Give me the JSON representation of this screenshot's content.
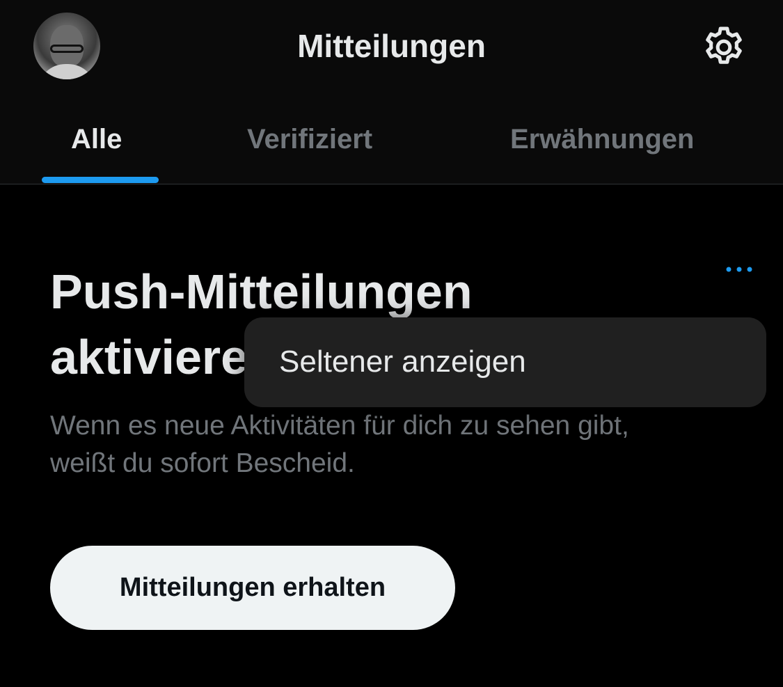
{
  "header": {
    "title": "Mitteilungen",
    "avatar_icon": "user-avatar",
    "settings_icon": "gear-icon"
  },
  "tabs": [
    {
      "label": "Alle",
      "active": true
    },
    {
      "label": "Verifiziert",
      "active": false
    },
    {
      "label": "Erwähnungen",
      "active": false
    }
  ],
  "prompt": {
    "headline": "Push-Mitteilungen aktivieren",
    "description": "Wenn es neue Aktivitäten für dich zu sehen gibt, weißt du sofort Bescheid.",
    "button_label": "Mitteilungen erhalten",
    "more_icon": "more-dots-icon"
  },
  "popup_menu": {
    "items": [
      {
        "label": "Seltener anzeigen"
      }
    ]
  },
  "colors": {
    "background": "#000000",
    "accent": "#1d9bf0",
    "text_primary": "#e7e9ea",
    "text_secondary": "#71767b",
    "button_bg": "#eff3f4",
    "menu_bg": "#202020"
  }
}
